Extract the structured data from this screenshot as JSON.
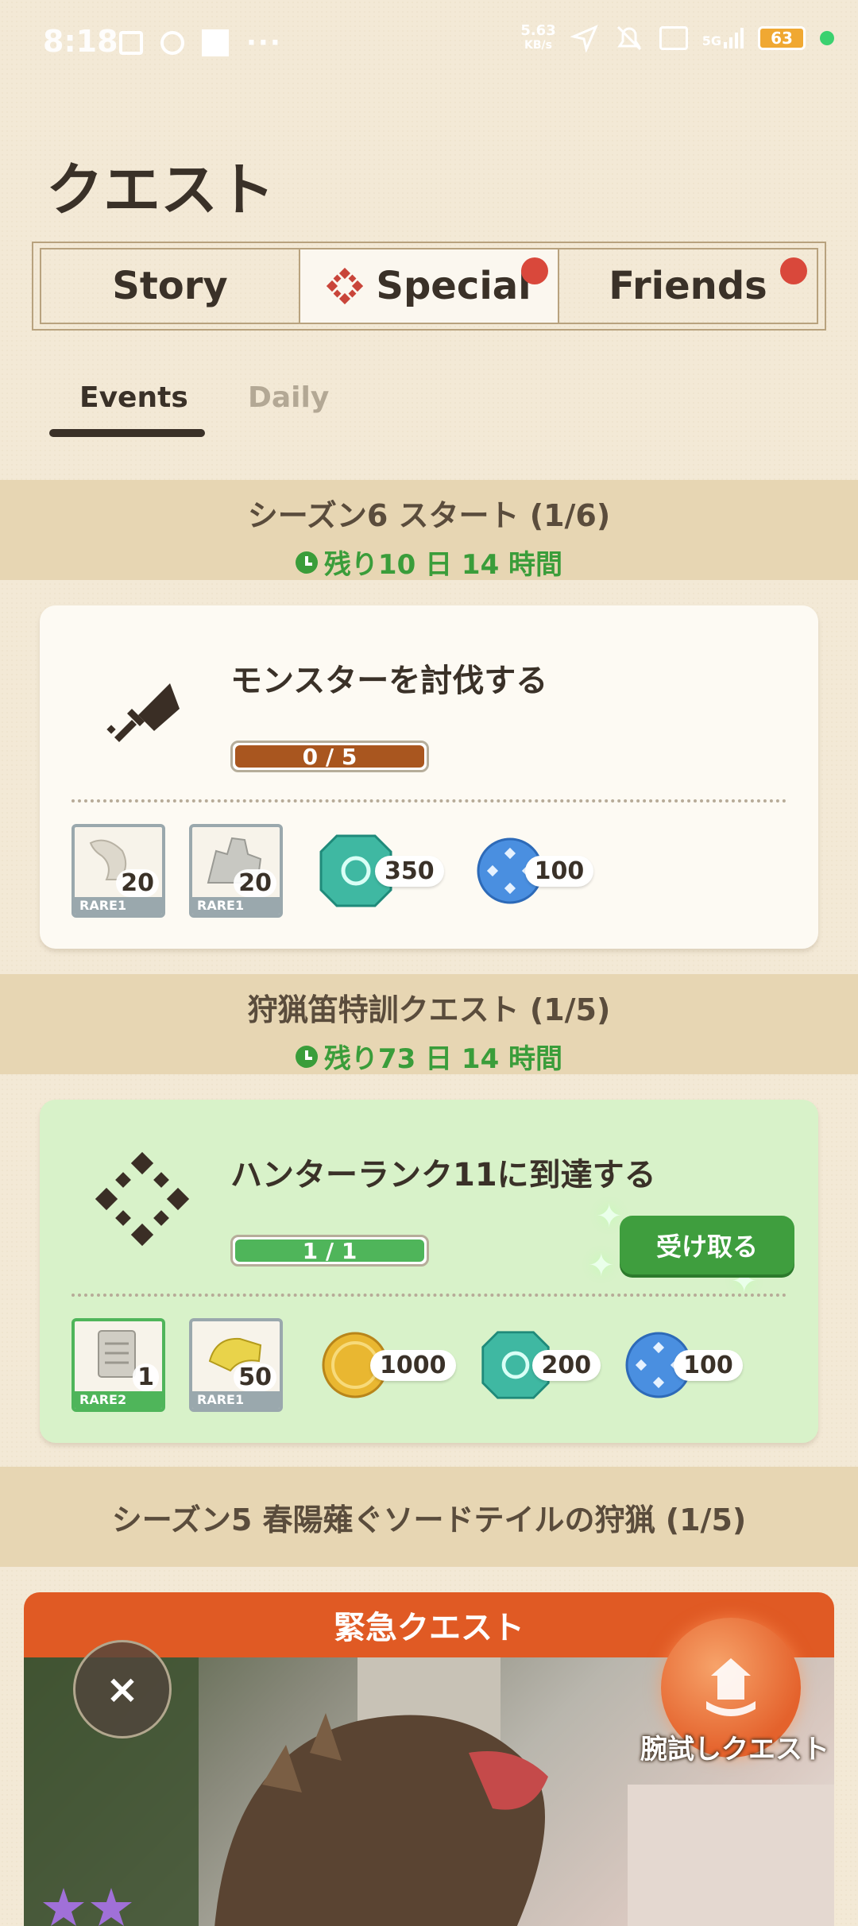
{
  "status_bar": {
    "time": "8:18",
    "network_speed_value": "5.63",
    "network_speed_unit": "KB/s",
    "signal": "5G",
    "battery": "63"
  },
  "page": {
    "title": "クエスト"
  },
  "tabs": [
    {
      "label": "Story",
      "active": false,
      "badge": false
    },
    {
      "label": "Special",
      "active": true,
      "badge": true,
      "icon": "diamond-emblem-icon"
    },
    {
      "label": "Friends",
      "active": false,
      "badge": true
    }
  ],
  "subtabs": [
    {
      "label": "Events",
      "active": true
    },
    {
      "label": "Daily",
      "active": false
    }
  ],
  "sections": [
    {
      "title": "シーズン6 スタート (1/6)",
      "timer": "残り10 日 14 時間",
      "quest": {
        "title": "モンスターを討伐する",
        "progress_text": "0 / 5",
        "progress": 0,
        "icon": "sword-icon",
        "rewards": [
          {
            "type": "item",
            "icon": "bone-item-icon",
            "qty": "20",
            "rarity": "RARE1"
          },
          {
            "type": "item",
            "icon": "monster-material-icon",
            "qty": "20",
            "rarity": "RARE1"
          },
          {
            "type": "currency",
            "icon": "green-gem-icon",
            "qty": "350"
          },
          {
            "type": "currency",
            "icon": "blue-emblem-coin-icon",
            "qty": "100"
          }
        ]
      }
    },
    {
      "title": "狩猟笛特訓クエスト (1/5)",
      "timer": "残り73 日 14 時間",
      "quest": {
        "title": "ハンターランク11に到達する",
        "progress_text": "1 / 1",
        "progress": 1,
        "icon": "diamond-emblem-icon",
        "claim_label": "受け取る",
        "rewards": [
          {
            "type": "item",
            "icon": "scroll-item-icon",
            "qty": "1",
            "rarity": "RARE2"
          },
          {
            "type": "item",
            "icon": "gold-horn-item-icon",
            "qty": "50",
            "rarity": "RARE1"
          },
          {
            "type": "currency",
            "icon": "gold-coin-icon",
            "qty": "1000"
          },
          {
            "type": "currency",
            "icon": "green-gem-icon",
            "qty": "200"
          },
          {
            "type": "currency",
            "icon": "blue-emblem-coin-icon",
            "qty": "100"
          }
        ]
      }
    },
    {
      "title": "シーズン5 春陽薙ぐソードテイルの狩猟 (1/5)"
    }
  ],
  "urgent": {
    "header": "緊急クエスト"
  },
  "fab": {
    "close_label": "×",
    "quest_label": "腕試しクエスト"
  },
  "colors": {
    "accent_orange": "#e05a24",
    "progress_brown": "#a9561f",
    "progress_green": "#4fb55a",
    "timer_green": "#3a9d3a",
    "badge_red": "#d9483b"
  }
}
